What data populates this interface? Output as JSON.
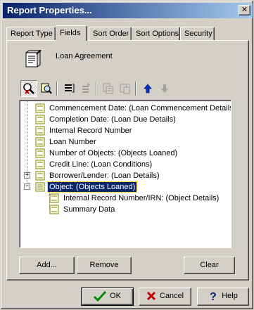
{
  "window": {
    "title": "Report Properties..."
  },
  "tabs": [
    {
      "label": "Report Type"
    },
    {
      "label": "Fields",
      "active": true
    },
    {
      "label": "Sort Order"
    },
    {
      "label": "Sort Options"
    },
    {
      "label": "Security"
    }
  ],
  "report": {
    "name": "Loan Agreement",
    "icon": "report-document-icon"
  },
  "toolbar": {
    "buttons": [
      {
        "icon": "field-search-icon",
        "pressed": true
      },
      {
        "icon": "field-browse-icon"
      },
      {
        "icon": "align-list-icon"
      },
      {
        "icon": "align-list-disabled-icon",
        "disabled": true
      },
      {
        "icon": "copy-field-icon",
        "disabled": true
      },
      {
        "icon": "paste-field-icon",
        "disabled": true
      },
      {
        "icon": "move-up-icon",
        "color": "#0033cc"
      },
      {
        "icon": "move-down-icon",
        "disabled": true
      }
    ]
  },
  "tree": {
    "items": [
      {
        "label": "Commencement Date: (Loan Commencement Details)",
        "level": 0
      },
      {
        "label": "Completion Date: (Loan Due Details)",
        "level": 0
      },
      {
        "label": "Internal Record Number",
        "level": 0
      },
      {
        "label": "Loan Number",
        "level": 0
      },
      {
        "label": "Number of Objects: (Objects Loaned)",
        "level": 0
      },
      {
        "label": "Credit Line: (Loan Conditions)",
        "level": 0
      },
      {
        "label": "Borrower/Lender: (Loan Details)",
        "level": 0,
        "expander": "+"
      },
      {
        "label": "Object: (Objects Loaned)",
        "level": 0,
        "expander": "-",
        "selected": true
      },
      {
        "label": "Internal Record Number/IRN: (Object Details)",
        "level": 1
      },
      {
        "label": "Summary Data",
        "level": 1
      }
    ]
  },
  "actions": {
    "add": "Add...",
    "remove": "Remove",
    "clear": "Clear"
  },
  "footer": {
    "ok": "OK",
    "cancel": "Cancel",
    "help": "Help",
    "colors": {
      "ok_check": "#0a8a0a",
      "cancel_x": "#c00000",
      "help_q": "#0a246a"
    }
  }
}
